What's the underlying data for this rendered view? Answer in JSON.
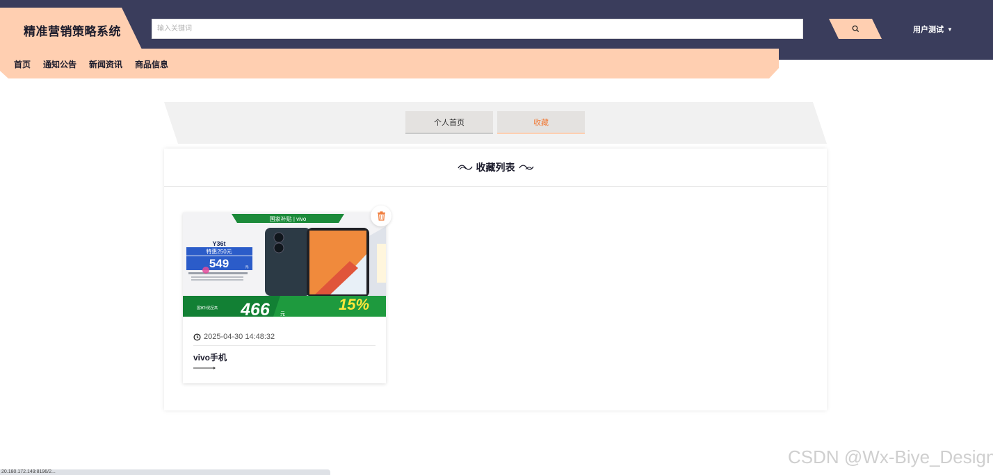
{
  "app": {
    "title": "精准营销策略系统"
  },
  "search": {
    "placeholder": "输入关键词",
    "icon": "search-icon"
  },
  "user": {
    "label": "用户测试",
    "icon": "caret-down-icon"
  },
  "nav": {
    "items": [
      "首页",
      "通知公告",
      "新闻资讯",
      "商品信息"
    ]
  },
  "tabs": {
    "home": "个人首页",
    "favorites": "收藏",
    "active": "favorites"
  },
  "panel": {
    "title": "收藏列表"
  },
  "favorites": [
    {
      "time": "2025-04-30 14:48:32",
      "title": "vivo手机",
      "image": {
        "banner": "国家补贴 | vivo",
        "model": "Y36t",
        "subsidy": "特惠250元",
        "price": "549",
        "price_unit": "元",
        "final_price": "466",
        "final_unit": "元",
        "discount": "15%",
        "discount_label": "国家补贴至高"
      }
    }
  ],
  "colors": {
    "header_bg": "#3a3d5c",
    "accent": "#ffcfb1",
    "active_tab_text": "#f07d3c",
    "trash": "#f07d3c"
  },
  "watermark": "CSDN @Wx-Biye_Design",
  "status_url": "20.180.172.149:8196/2..."
}
